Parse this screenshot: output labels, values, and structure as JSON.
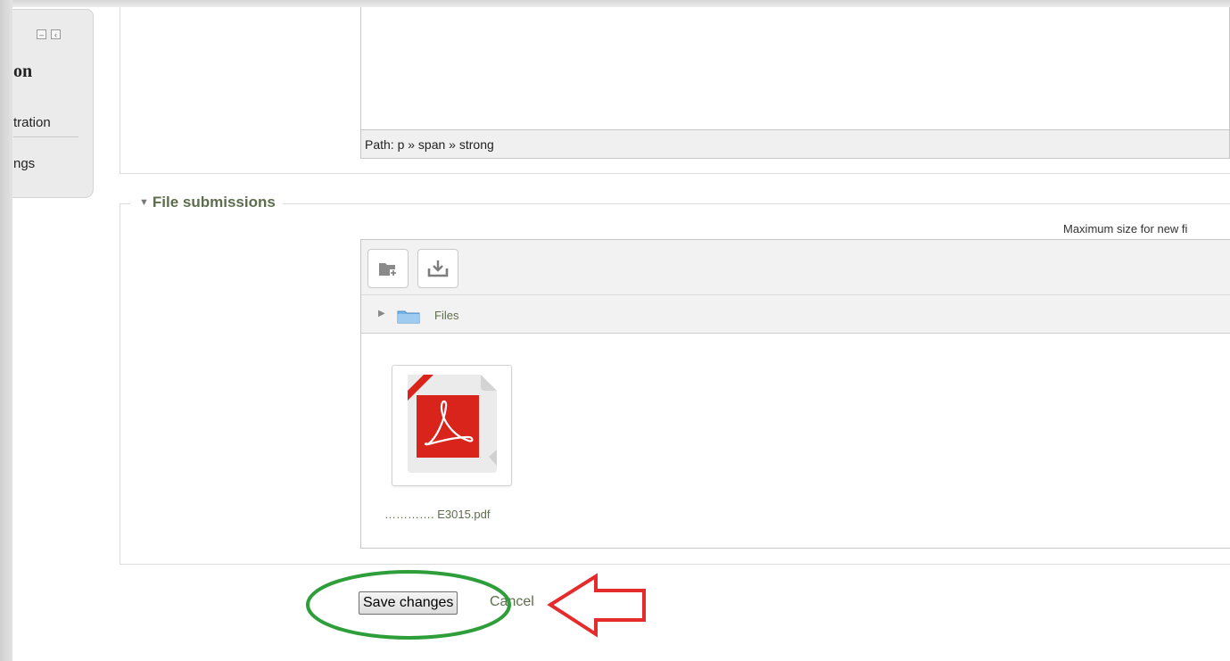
{
  "sidebar": {
    "title": "on",
    "item1": "tration",
    "item2": "ngs",
    "collapse_icon": "minus-square-icon",
    "dock_icon": "chevron-left-square-icon"
  },
  "editor": {
    "path_text": "Path: p » span » strong"
  },
  "file_submissions": {
    "legend": "File submissions",
    "max_size_text": "Maximum size for new fi",
    "toolbar": {
      "create_folder_icon": "folder-add-icon",
      "download_icon": "download-icon"
    },
    "path_label": "Files",
    "files": [
      {
        "name": "…………. E3015.pdf",
        "icon": "pdf-file-icon"
      }
    ]
  },
  "actions": {
    "save_label": "Save changes",
    "cancel_label": "Cancel"
  },
  "colors": {
    "link_green": "#5d6e4d",
    "annotation_ellipse": "#2e9e3a",
    "annotation_arrow": "#e52b2b",
    "pdf_red": "#e32a20"
  }
}
